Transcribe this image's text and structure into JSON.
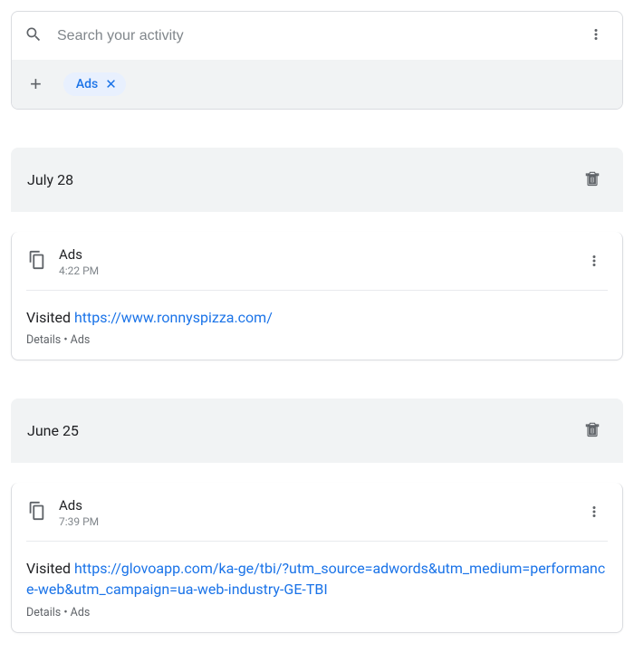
{
  "search": {
    "placeholder": "Search your activity"
  },
  "filter_chip": {
    "label": "Ads"
  },
  "groups": [
    {
      "date": "July 28",
      "items": [
        {
          "app": "Ads",
          "time": "4:22 PM",
          "prefix": "Visited ",
          "url": "https://www.ronnyspizza.com/",
          "meta": "Details • Ads"
        }
      ]
    },
    {
      "date": "June 25",
      "items": [
        {
          "app": "Ads",
          "time": "7:39 PM",
          "prefix": "Visited ",
          "url": "https://glovoapp.com/ka-ge/tbi/?utm_source=adwords&utm_medium=performance-web&utm_campaign=ua-web-industry-GE-TBI",
          "meta": "Details • Ads"
        }
      ]
    }
  ]
}
